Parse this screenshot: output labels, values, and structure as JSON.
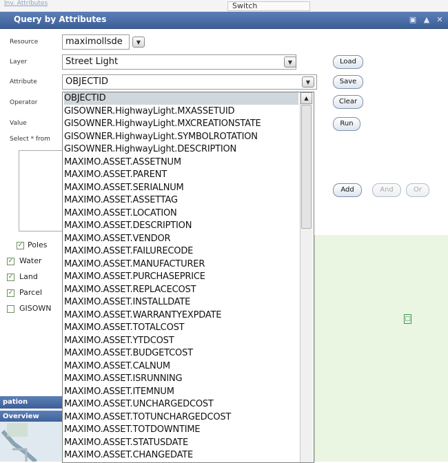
{
  "top_strip": {
    "faint_link": "Inv. Attributes",
    "cut_text": "Switch"
  },
  "panel": {
    "title": "Query by Attributes"
  },
  "form": {
    "resource_label": "Resource",
    "resource_value": "maximollsde",
    "layer_label": "Layer",
    "layer_value": "Street Light",
    "attribute_label": "Attribute",
    "attribute_value": "OBJECTID",
    "operator_label": "Operator",
    "value_label": "Value",
    "select_label": "Select * from"
  },
  "buttons": {
    "load": "Load",
    "save": "Save",
    "clear": "Clear",
    "run": "Run",
    "add": "Add",
    "and": "And",
    "or": "Or"
  },
  "attribute_options": [
    "OBJECTID",
    "GISOWNER.HighwayLight.MXASSETUID",
    "GISOWNER.HighwayLight.MXCREATIONSTATE",
    "GISOWNER.HighwayLight.SYMBOLROTATION",
    "GISOWNER.HighwayLight.DESCRIPTION",
    "MAXIMO.ASSET.ASSETNUM",
    "MAXIMO.ASSET.PARENT",
    "MAXIMO.ASSET.SERIALNUM",
    "MAXIMO.ASSET.ASSETTAG",
    "MAXIMO.ASSET.LOCATION",
    "MAXIMO.ASSET.DESCRIPTION",
    "MAXIMO.ASSET.VENDOR",
    "MAXIMO.ASSET.FAILURECODE",
    "MAXIMO.ASSET.MANUFACTURER",
    "MAXIMO.ASSET.PURCHASEPRICE",
    "MAXIMO.ASSET.REPLACECOST",
    "MAXIMO.ASSET.INSTALLDATE",
    "MAXIMO.ASSET.WARRANTYEXPDATE",
    "MAXIMO.ASSET.TOTALCOST",
    "MAXIMO.ASSET.YTDCOST",
    "MAXIMO.ASSET.BUDGETCOST",
    "MAXIMO.ASSET.CALNUM",
    "MAXIMO.ASSET.ISRUNNING",
    "MAXIMO.ASSET.ITEMNUM",
    "MAXIMO.ASSET.UNCHARGEDCOST",
    "MAXIMO.ASSET.TOTUNCHARGEDCOST",
    "MAXIMO.ASSET.TOTDOWNTIME",
    "MAXIMO.ASSET.STATUSDATE",
    "MAXIMO.ASSET.CHANGEDATE"
  ],
  "selected_option": "OBJECTID",
  "layers": [
    {
      "label": "Poles",
      "checked": true
    },
    {
      "label": "Water",
      "checked": true
    },
    {
      "label": "Land",
      "checked": true
    },
    {
      "label": "Parcel",
      "checked": true
    },
    {
      "label": "GISOWN",
      "checked": false
    }
  ],
  "nav": {
    "navigation_label": "pation",
    "overview_label": "Overview"
  },
  "icons": [
    "window-icon",
    "collapse-icon",
    "close-icon",
    "chevron-down-icon",
    "scroll-up-icon",
    "check-icon",
    "map-marker-icon"
  ],
  "colors": {
    "titlebar": "#3d5f98",
    "map_bg": "#eaf5e2",
    "selected_row": "#cfd6dc"
  }
}
